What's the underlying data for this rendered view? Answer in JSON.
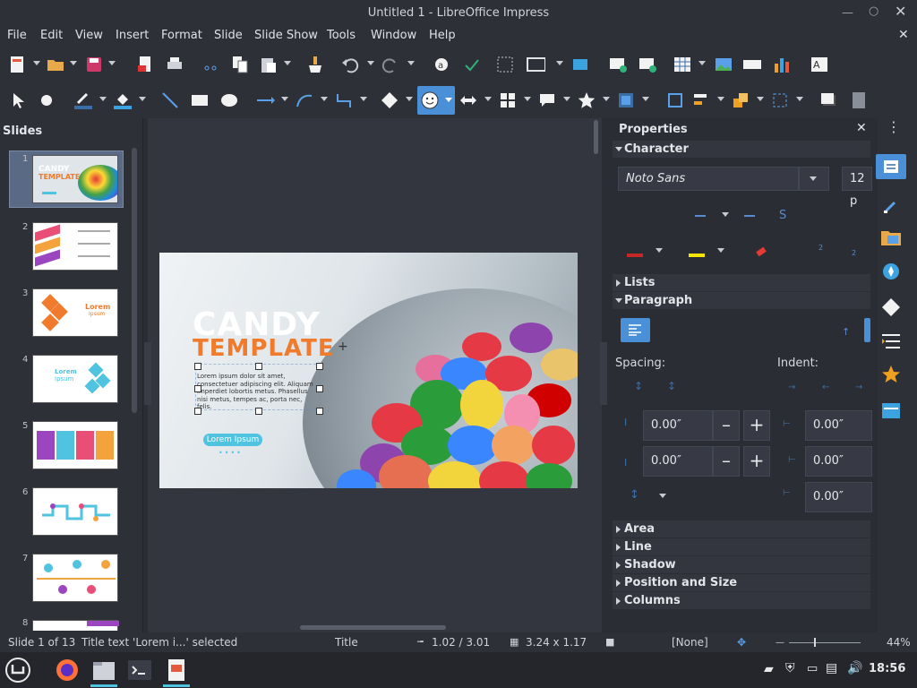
{
  "window": {
    "title": "Untitled 1 - LibreOffice Impress"
  },
  "menus": [
    "File",
    "Edit",
    "View",
    "Insert",
    "Format",
    "Slide",
    "Slide Show",
    "Tools",
    "Window",
    "Help"
  ],
  "slides_panel": {
    "title": "Slides",
    "numbers": [
      "1",
      "2",
      "3",
      "4",
      "5",
      "6",
      "7",
      "8"
    ]
  },
  "slide": {
    "title1": "CANDY",
    "title2": "TEMPLATE",
    "body": "Lorem ipsum dolor sit amet, consectetuer adipiscing elit. Aliquam imperdiet lobortis metus. Phasellus nisi metus, tempes ac, porta nec, felis.",
    "button": "Lorem Ipsum",
    "thumb3_heading": "Lorem",
    "thumb3_sub": "Ipsum",
    "thumb4_heading": "Lorem",
    "thumb4_sub": "Ipsum",
    "thumb1_title1": "CANDY",
    "thumb1_title2": "TEMPLATE"
  },
  "properties": {
    "title": "Properties",
    "character": "Character",
    "font_name": "Noto Sans",
    "font_size": "12 p",
    "lists": "Lists",
    "paragraph": "Paragraph",
    "spacing": "Spacing:",
    "indent": "Indent:",
    "spacing_above": "0.00″",
    "spacing_below": "0.00″",
    "indent_before": "0.00″",
    "indent_after": "0.00″",
    "indent_first": "0.00″",
    "sections": [
      "Area",
      "Line",
      "Shadow",
      "Position and Size",
      "Columns"
    ]
  },
  "status": {
    "slide": "Slide 1 of 13",
    "selection": "Title text 'Lorem i...' selected",
    "layout": "Title",
    "position": "1.02 / 3.01",
    "size": "3.24 x 1.17",
    "master": "[None]",
    "zoom": "44%"
  },
  "taskbar": {
    "clock": "18:56"
  },
  "colors": {
    "accent": "#4a90d9",
    "title_orange": "#f07b2c",
    "button_teal": "#4fc3e0"
  }
}
